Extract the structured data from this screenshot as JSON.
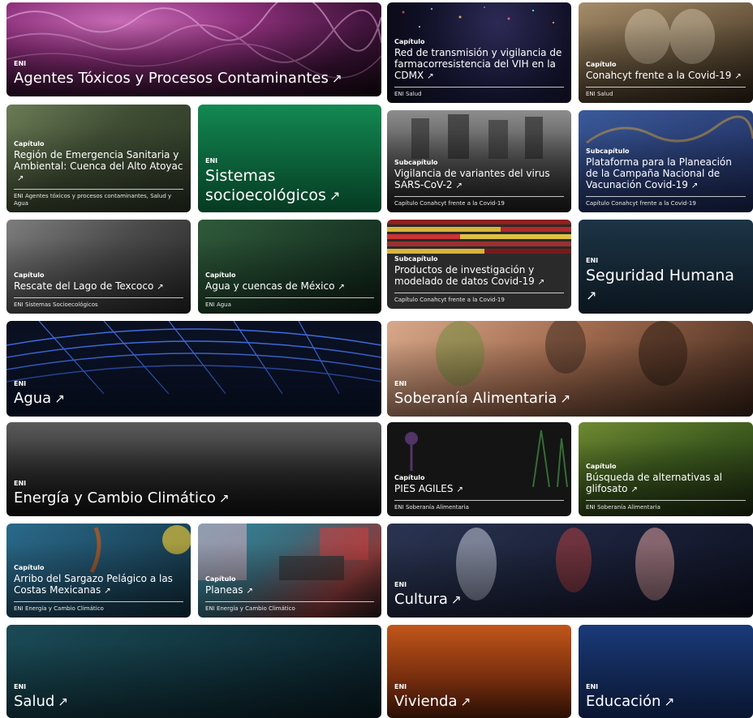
{
  "tiles": {
    "t_agentes": {
      "kicker": "ENI",
      "title": "Agentes Tóxicos y Procesos Contaminantes",
      "arrow": "↗"
    },
    "t_red": {
      "kicker": "Capítulo",
      "title": "Red de transmisión y vigilancia de farmacorresistencia del VIH en la CDMX",
      "arrow": "↗",
      "meta": "ENI Salud"
    },
    "t_conahcyt": {
      "kicker": "Capítulo",
      "title": "Conahcyt frente a la Covid-19",
      "arrow": "↗",
      "meta": "ENI Salud"
    },
    "t_region": {
      "kicker": "Capítulo",
      "title": "Región de Emergencia Sanitaria y Ambiental: Cuenca del Alto Atoyac",
      "arrow": "↗",
      "meta": "ENI Agentes tóxicos y procesos contaminantes, Salud y Agua"
    },
    "t_sistemas": {
      "kicker": "ENI",
      "title": "Sistemas socioecológicos",
      "arrow": "↗"
    },
    "t_vigilancia": {
      "kicker": "Subcapítulo",
      "title": "Vigilancia de variantes del virus SARS-CoV-2",
      "arrow": "↗",
      "meta": "Capítulo Conahcyt frente a la Covid-19"
    },
    "t_plataforma": {
      "kicker": "Subcapítulo",
      "title": "Plataforma para la Planeación de la Campaña Nacional de Vacunación Covid-19",
      "arrow": "↗",
      "meta": "Capítulo Conahcyt frente a la Covid-19"
    },
    "t_texcoco": {
      "kicker": "Capítulo",
      "title": "Rescate del Lago de Texcoco",
      "arrow": "↗",
      "meta": "ENI Sistemas Socioecológicos"
    },
    "t_cuencas": {
      "kicker": "Capítulo",
      "title": "Agua y cuencas de México",
      "arrow": "↗",
      "meta": "ENI Agua"
    },
    "t_productos": {
      "kicker": "Subcapítulo",
      "title": "Productos de investigación y modelado de datos Covid-19",
      "arrow": "↗",
      "meta": "Capítulo Conahcyt frente a la Covid-19"
    },
    "t_seguridad": {
      "kicker": "ENI",
      "title": "Seguridad Humana",
      "arrow": "↗"
    },
    "t_agua": {
      "kicker": "ENI",
      "title": "Agua",
      "arrow": "↗"
    },
    "t_soberania": {
      "kicker": "ENI",
      "title": "Soberanía Alimentaria",
      "arrow": "↗"
    },
    "t_energia": {
      "kicker": "ENI",
      "title": "Energía y Cambio Climático",
      "arrow": "↗"
    },
    "t_pies": {
      "kicker": "Capítulo",
      "title": "PIES AGILES",
      "arrow": "↗",
      "meta": "ENI Soberanía Alimentaria"
    },
    "t_glifosato": {
      "kicker": "Capítulo",
      "title": "Búsqueda de alternativas al glifosato",
      "arrow": "↗",
      "meta": "ENI Soberanía Alimentaria"
    },
    "t_sargazo": {
      "kicker": "Capítulo",
      "title": "Arribo del Sargazo Pelágico a las Costas Mexicanas",
      "arrow": "↗",
      "meta": "ENI Energía y Cambio Climático"
    },
    "t_planeas": {
      "kicker": "Capítulo",
      "title": "Planeas",
      "arrow": "↗",
      "meta": "ENI Energía y Cambio Climático"
    },
    "t_cultura": {
      "kicker": "ENI",
      "title": "Cultura",
      "arrow": "↗"
    },
    "t_salud": {
      "kicker": "ENI",
      "title": "Salud",
      "arrow": "↗"
    },
    "t_vivienda": {
      "kicker": "ENI",
      "title": "Vivienda",
      "arrow": "↗"
    },
    "t_educacion": {
      "kicker": "ENI",
      "title": "Educación",
      "arrow": "↗"
    }
  }
}
